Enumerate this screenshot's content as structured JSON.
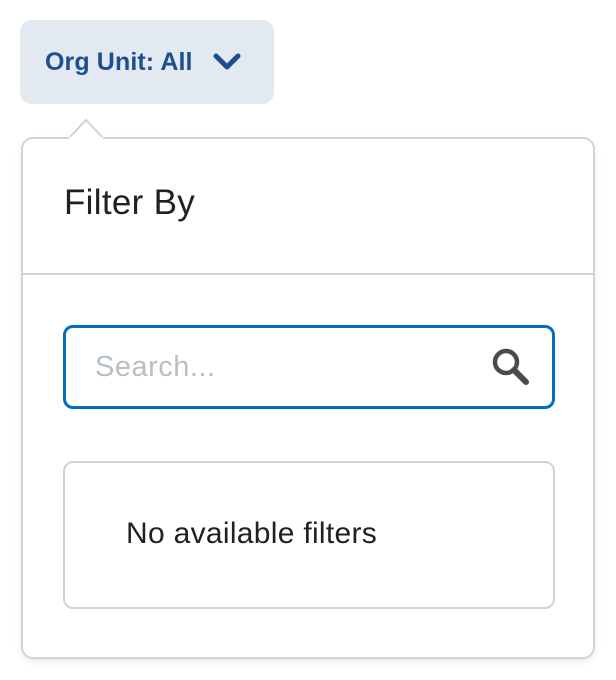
{
  "filter_opener": {
    "label": "Org Unit: All",
    "icon": "chevron-down-icon",
    "color": "#1d4f8f",
    "background": "#e3e9f1"
  },
  "dropdown": {
    "title": "Filter By",
    "search": {
      "value": "",
      "placeholder": "Search...",
      "icon": "search-icon",
      "border_color": "#006fbf"
    },
    "empty_state": {
      "message": "No available filters"
    }
  }
}
